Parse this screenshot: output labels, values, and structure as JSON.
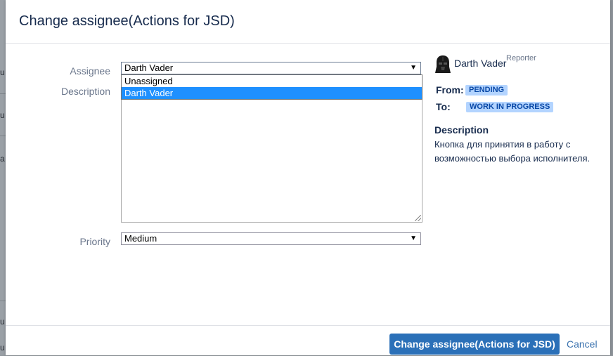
{
  "dialog": {
    "title": "Change assignee(Actions for JSD)"
  },
  "background_fragments": [
    "u",
    "u",
    "a",
    "u",
    "u"
  ],
  "form": {
    "assignee": {
      "label": "Assignee",
      "value": "Darth Vader",
      "options": [
        "Unassigned",
        "Darth Vader"
      ],
      "highlighted_option": "Darth Vader"
    },
    "description": {
      "label": "Description",
      "value": ""
    },
    "priority": {
      "label": "Priority",
      "value": "Medium"
    }
  },
  "side_panel": {
    "reporter": {
      "name": "Darth Vader",
      "role": "Reporter",
      "avatar_icon": "darth-vader-avatar"
    },
    "transition": {
      "from_label": "From:",
      "from_status": "PENDING",
      "to_label": "To:",
      "to_status": "WORK IN PROGRESS"
    },
    "description_heading": "Description",
    "description_text": "Кнопка для принятия в работу с возможностью выбора исполнителя."
  },
  "footer": {
    "submit_label": "Change assignee(Actions for JSD)",
    "cancel_label": "Cancel"
  },
  "colors": {
    "primary_button": "#2b70b8",
    "lozenge_bg": "#b3d4ff",
    "lozenge_text": "#0747a6",
    "link": "#3b73af",
    "dropdown_highlight": "#1e90ff"
  }
}
